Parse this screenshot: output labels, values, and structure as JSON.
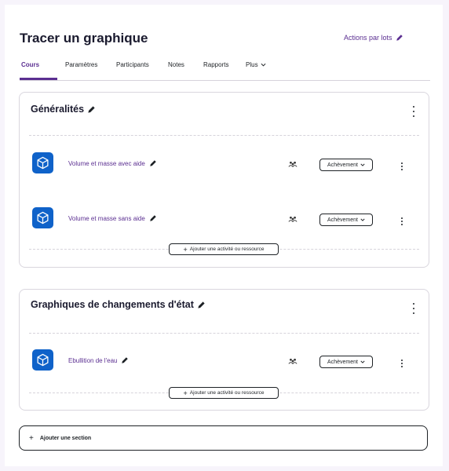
{
  "page": {
    "title": "Tracer un graphique",
    "bulk_actions_label": "Actions par lots"
  },
  "tabs": [
    {
      "label": "Cours",
      "active": true
    },
    {
      "label": "Paramètres"
    },
    {
      "label": "Participants"
    },
    {
      "label": "Notes"
    },
    {
      "label": "Rapports"
    },
    {
      "label": "Plus"
    }
  ],
  "sections": [
    {
      "title": "Généralités",
      "activities": [
        {
          "name": "Volume et masse avec aide",
          "completion_label": "Achèvement"
        },
        {
          "name": "Volume et masse sans aide",
          "completion_label": "Achèvement"
        }
      ],
      "add_activity_label": "Ajouter une activité ou ressource"
    },
    {
      "title": "Graphiques de changements d'état",
      "activities": [
        {
          "name": "Ebullition de l'eau",
          "completion_label": "Achèvement"
        }
      ],
      "add_activity_label": "Ajouter une activité ou ressource"
    }
  ],
  "add_section_label": "Ajouter une section",
  "colors": {
    "accent": "#5b2f91",
    "activity_icon_bg": "#0f62c9"
  },
  "icons": [
    "pencil-icon",
    "kebab-menu-icon",
    "cube-icon",
    "group-mode-icon",
    "chevron-down-icon",
    "plus-icon"
  ]
}
